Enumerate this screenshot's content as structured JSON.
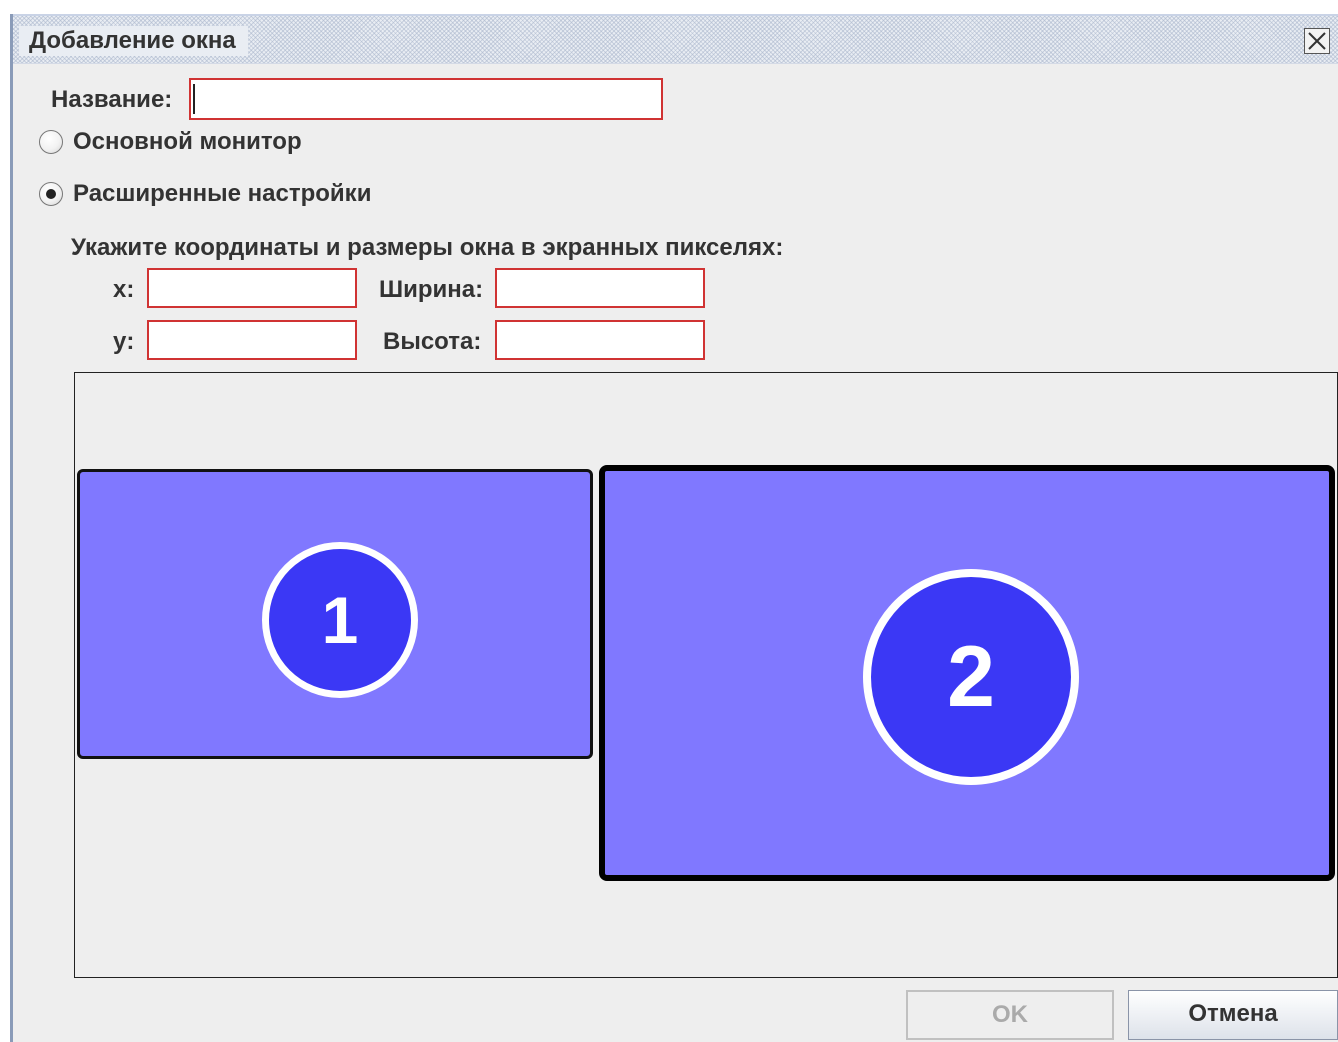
{
  "window": {
    "title": "Добавление окна",
    "close_icon": "close-icon"
  },
  "form": {
    "name_label": "Название:",
    "name_value": "",
    "radio_primary_label": "Основной монитор",
    "radio_primary_selected": false,
    "radio_advanced_label": "Расширенные настройки",
    "radio_advanced_selected": true,
    "instructions": "Укажите координаты и размеры окна в экранных пикселях:",
    "x_label": "x:",
    "x_value": "",
    "y_label": "y:",
    "y_value": "",
    "width_label": "Ширина:",
    "width_value": "",
    "height_label": "Высота:",
    "height_value": ""
  },
  "monitors": [
    {
      "number": "1",
      "fill_color": "#8078ff",
      "badge_color": "#3b38f5"
    },
    {
      "number": "2",
      "fill_color": "#8078ff",
      "badge_color": "#3b38f5"
    }
  ],
  "buttons": {
    "ok_label": "OK",
    "ok_enabled": false,
    "cancel_label": "Отмена"
  },
  "colors": {
    "invalid_field_border": "#d03333",
    "dialog_background": "#eeeeee"
  }
}
